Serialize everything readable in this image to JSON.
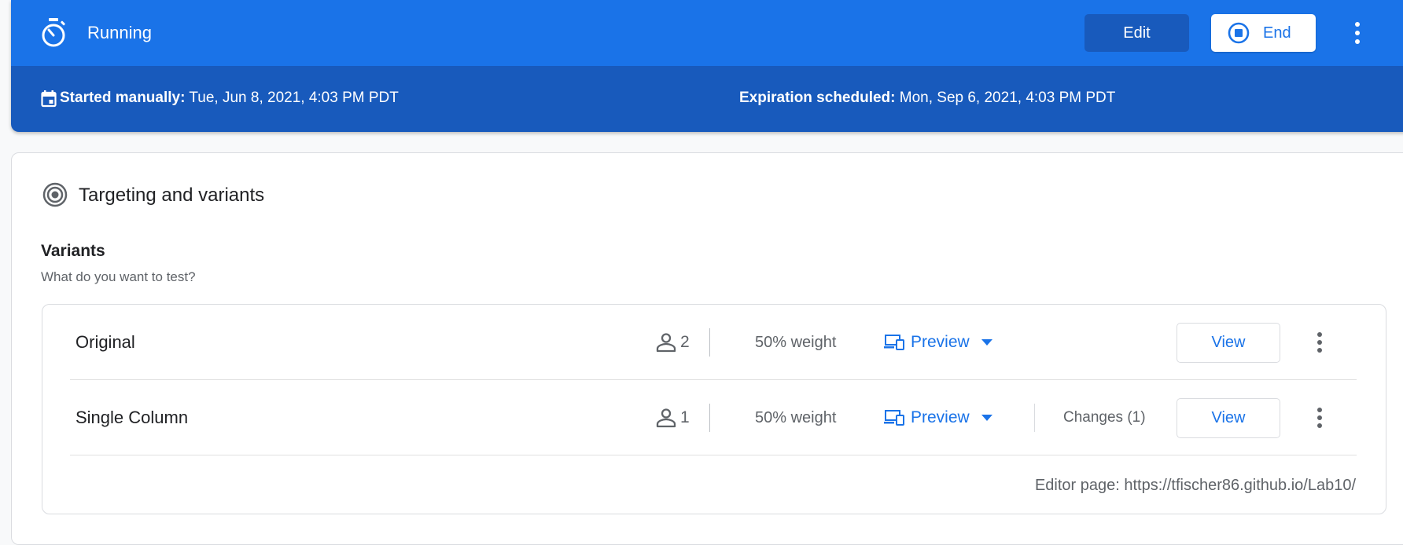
{
  "header": {
    "status": "Running",
    "edit_label": "Edit",
    "end_label": "End",
    "started_label": "Started manually:",
    "started_value": "Tue, Jun 8, 2021, 4:03 PM PDT",
    "expiration_label": "Expiration scheduled:",
    "expiration_value": "Mon, Sep 6, 2021, 4:03 PM PDT"
  },
  "section": {
    "title": "Targeting and variants",
    "variants_title": "Variants",
    "variants_subtitle": "What do you want to test?"
  },
  "variants": [
    {
      "name": "Original",
      "count": "2",
      "weight": "50% weight",
      "preview_label": "Preview",
      "view_label": "View"
    },
    {
      "name": "Single Column",
      "count": "1",
      "weight": "50% weight",
      "preview_label": "Preview",
      "changes_label": "Changes (1)",
      "view_label": "View"
    }
  ],
  "editor_page": "Editor page: https://tfischer86.github.io/Lab10/",
  "icons": {
    "status": "timer-icon",
    "end": "stop-circle-icon",
    "menu": "more-vert-icon",
    "calendar": "calendar-icon",
    "section": "target-icon",
    "person": "person-icon",
    "preview": "devices-icon",
    "caret": "arrow-drop-down-icon"
  },
  "colors": {
    "primary": "#1a73e8",
    "primary_dark": "#185abc",
    "text_secondary": "#5f6368"
  }
}
